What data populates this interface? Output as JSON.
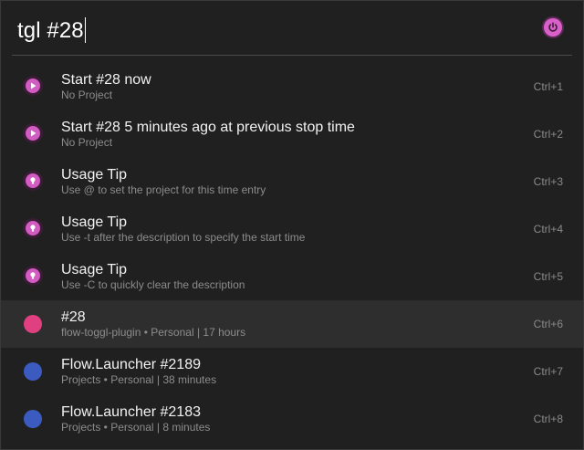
{
  "query": {
    "text": "tgl #28"
  },
  "plugin_badge_icon": "power-icon",
  "results": [
    {
      "icon": "play-icon",
      "icon_style": "pink-play",
      "title": "Start #28 now",
      "subtitle": "No Project",
      "hotkey": "Ctrl+1",
      "selected": false
    },
    {
      "icon": "play-icon",
      "icon_style": "pink-play",
      "title": "Start #28 5 minutes ago at previous stop time",
      "subtitle": "No Project",
      "hotkey": "Ctrl+2",
      "selected": false
    },
    {
      "icon": "lightbulb-icon",
      "icon_style": "pink-tip",
      "title": "Usage Tip",
      "subtitle": "Use @ to set the project for this time entry",
      "hotkey": "Ctrl+3",
      "selected": false
    },
    {
      "icon": "lightbulb-icon",
      "icon_style": "pink-tip",
      "title": "Usage Tip",
      "subtitle": "Use -t after the description to specify the start time",
      "hotkey": "Ctrl+4",
      "selected": false
    },
    {
      "icon": "lightbulb-icon",
      "icon_style": "pink-tip",
      "title": "Usage Tip",
      "subtitle": "Use -C to quickly clear the description",
      "hotkey": "Ctrl+5",
      "selected": false
    },
    {
      "icon": "project-color-dot-icon",
      "icon_style": "dot-pink",
      "title": "#28",
      "subtitle": "flow-toggl-plugin • Personal | 17 hours",
      "hotkey": "Ctrl+6",
      "selected": true
    },
    {
      "icon": "project-color-dot-icon",
      "icon_style": "dot-blue",
      "title": "Flow.Launcher #2189",
      "subtitle": "Projects • Personal | 38 minutes",
      "hotkey": "Ctrl+7",
      "selected": false
    },
    {
      "icon": "project-color-dot-icon",
      "icon_style": "dot-blue",
      "title": "Flow.Launcher #2183",
      "subtitle": "Projects • Personal | 8 minutes",
      "hotkey": "Ctrl+8",
      "selected": false
    }
  ],
  "colors": {
    "background": "#202020",
    "accent_pink": "#d25cc2",
    "project_pink": "#e0407f",
    "project_blue": "#3c5bc0",
    "selected_row": "#2e2e2e"
  }
}
